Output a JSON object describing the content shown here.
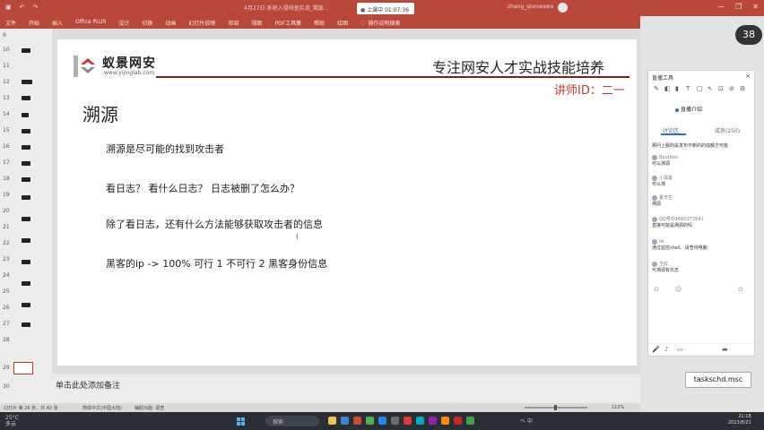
{
  "titlebar": {
    "app_logo": "wps-logo",
    "left_buttons": [
      "save-icon",
      "undo-icon",
      "redo-icon"
    ],
    "document_title": "4月27日-系统入侵排查实战_溯源...",
    "recording": "上课中 01:07:36",
    "user": "zhang_qianwawa",
    "window_controls": [
      "—",
      "❐",
      "✕"
    ]
  },
  "ribbon": {
    "tabs": [
      "文件",
      "开始",
      "插入",
      "Office PLUS",
      "设计",
      "切换",
      "动画",
      "幻灯片放映",
      "审阅",
      "视图",
      "PDF工具集",
      "帮助",
      "绘图"
    ],
    "search_hint": "操作说明搜索"
  },
  "thumbnails": {
    "numbers": [
      "9",
      "10",
      "11",
      "12",
      "13",
      "14",
      "15",
      "16",
      "17",
      "18",
      "19",
      "20",
      "21",
      "22",
      "23",
      "24",
      "25",
      "26",
      "27",
      "28",
      "29",
      "30"
    ]
  },
  "slide": {
    "logo_name": "蚁景网安",
    "logo_url": "www.yijinglab.com",
    "slogan": "专注网安人才实战技能培养",
    "lecturer": "讲师ID：二一",
    "title": "溯源",
    "bullets": [
      "溯源是尽可能的找到攻击者",
      "看日志？ 看什么日志？ 日志被删了怎么办？",
      "除了看日志，还有什么方法能够获取攻击者的信息",
      "黑客的ip  -> 100%  可行 1  不可行 2  黑客身份信息"
    ]
  },
  "notes_placeholder": "单击此处添加备注",
  "statusbar": {
    "slide_info": "幻灯片 第 26 张，共 42 张",
    "language": "简体中文(中国大陆)",
    "accessibility": "辅助功能: 调查",
    "zoom": "112%"
  },
  "live_panel": {
    "header": "直播工具",
    "status": "直播介绍",
    "tabs": [
      "讨论区",
      "成员(250)"
    ],
    "messages": [
      {
        "user": "",
        "text": "那问上服的是发布不断的的成都方可能"
      },
      {
        "user": "Bourbon",
        "text": "可以溯源"
      },
      {
        "user": "小黑客",
        "text": "可以溯"
      },
      {
        "user": "夏天生",
        "text": "溯源"
      },
      {
        "user": "QQ号中1660173541",
        "text": "直接可能是溯源的吗"
      },
      {
        "user": "ok",
        "text": "通过监控shell、请查询电脑"
      },
      {
        "user": "王红",
        "text": "可溯源有日志"
      }
    ]
  },
  "taskschd_label": "taskschd.msc",
  "badge": "38",
  "taskbar": {
    "weather_temp": "25°C",
    "weather_desc": "多云",
    "search_placeholder": "搜索",
    "tray_text": "へ 中",
    "time": "21:18",
    "date": "2023/8/21"
  },
  "colors": {
    "title_red": "#b9473a",
    "accent_red": "#c0392b",
    "header_line": "#8b1a1a",
    "taskbar": "#2a2f35"
  }
}
